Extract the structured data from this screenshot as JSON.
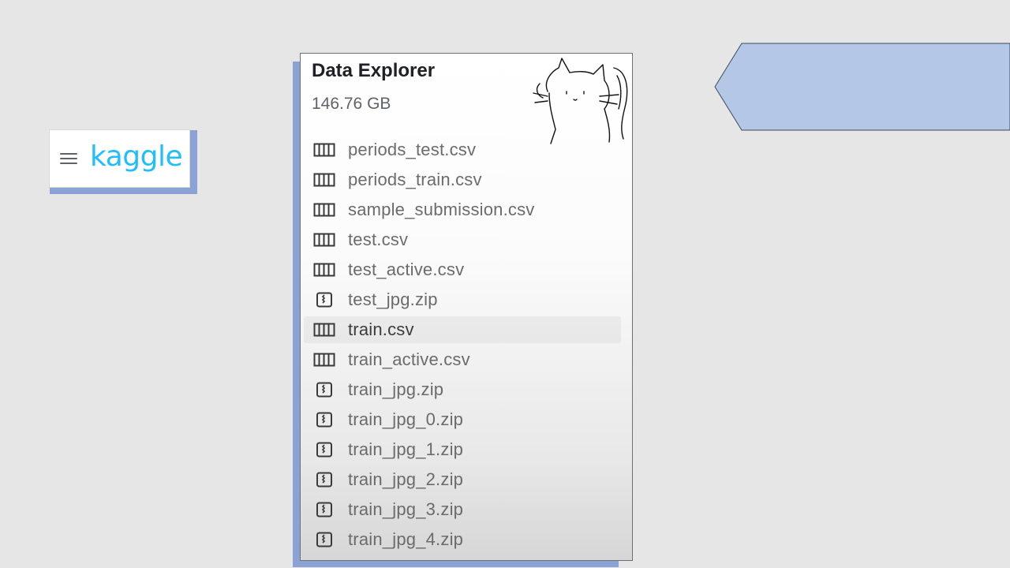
{
  "logo": {
    "brand": "kaggle"
  },
  "data_explorer": {
    "title": "Data Explorer",
    "size": "146.76 GB",
    "files": [
      {
        "name": "periods_test.csv",
        "icon": "table-icon"
      },
      {
        "name": "periods_train.csv",
        "icon": "table-icon"
      },
      {
        "name": "sample_submission.csv",
        "icon": "table-icon"
      },
      {
        "name": "test.csv",
        "icon": "table-icon"
      },
      {
        "name": "test_active.csv",
        "icon": "table-icon"
      },
      {
        "name": "test_jpg.zip",
        "icon": "zip-icon"
      },
      {
        "name": "train.csv",
        "icon": "table-icon",
        "highlighted": true
      },
      {
        "name": "train_active.csv",
        "icon": "table-icon"
      },
      {
        "name": "train_jpg.zip",
        "icon": "zip-icon"
      },
      {
        "name": "train_jpg_0.zip",
        "icon": "zip-icon"
      },
      {
        "name": "train_jpg_1.zip",
        "icon": "zip-icon"
      },
      {
        "name": "train_jpg_2.zip",
        "icon": "zip-icon"
      },
      {
        "name": "train_jpg_3.zip",
        "icon": "zip-icon"
      },
      {
        "name": "train_jpg_4.zip",
        "icon": "zip-icon"
      }
    ]
  },
  "colors": {
    "background": "#e6e6e6",
    "accent_shadow": "#8aa2d4",
    "arrow_fill": "#b4c7e7",
    "kaggle_blue": "#20beff"
  }
}
